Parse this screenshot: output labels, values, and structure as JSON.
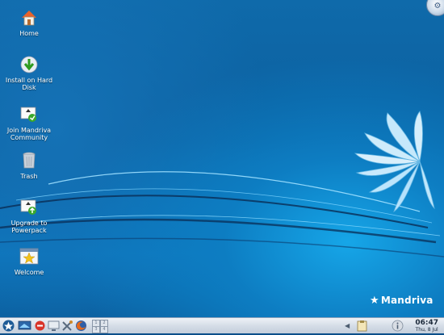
{
  "desktop": {
    "icons": [
      {
        "label": "Home",
        "icon": "home-icon"
      },
      {
        "label": "Install on Hard Disk",
        "icon": "install-icon"
      },
      {
        "label": "Join Mandriva Community",
        "icon": "join-community-icon"
      },
      {
        "label": "Trash",
        "icon": "trash-icon"
      },
      {
        "label": "Upgrade to Powerpack",
        "icon": "upgrade-icon"
      },
      {
        "label": "Welcome",
        "icon": "welcome-icon"
      }
    ],
    "brand": "Mandriva",
    "colors": {
      "background": "#0b5f9f",
      "accent": "#16a6e8",
      "taskbar": "#d5dde7"
    }
  },
  "taskbar": {
    "launchers": [
      "start-menu-icon",
      "desktop-icon",
      "stop-icon",
      "computer-icon",
      "tools-icon",
      "firefox-icon"
    ],
    "pager": [
      "1",
      "2",
      "3",
      "4"
    ],
    "tray": [
      "clipboard-icon",
      "info-icon"
    ],
    "clock": {
      "time": "06:47",
      "date": "Thu, 8 Jul"
    }
  }
}
